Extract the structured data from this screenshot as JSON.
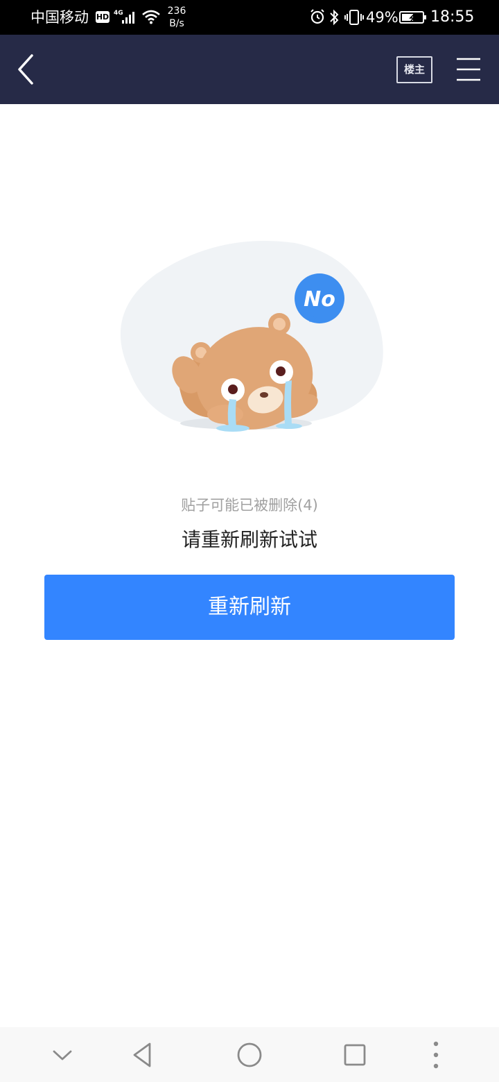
{
  "status_bar": {
    "carrier": "中国移动",
    "hd_badge": "HD",
    "network_type": "4G",
    "speed_value": "236",
    "speed_unit": "B/s",
    "battery_percent": "49%",
    "time": "18:55",
    "icons": [
      "signal-icon",
      "wifi-icon",
      "alarm-icon",
      "bluetooth-icon",
      "vibrate-icon",
      "battery-icon"
    ]
  },
  "nav": {
    "back_icon": "chevron-left-icon",
    "owner_label": "楼主",
    "menu_icon": "hamburger-menu-icon"
  },
  "illustration": {
    "bubble_text": "No"
  },
  "content": {
    "error_message": "贴子可能已被删除(4)",
    "hint": "请重新刷新试试",
    "refresh_button": "重新刷新"
  },
  "system_nav": {
    "icons": [
      "collapse-chevron-icon",
      "back-triangle-icon",
      "home-circle-icon",
      "recents-square-icon",
      "more-dots-icon"
    ]
  },
  "colors": {
    "nav_background": "#262a47",
    "button_blue": "#3385ff",
    "bubble_blue": "#3d8ef0",
    "bear_brown": "#e0a676"
  }
}
